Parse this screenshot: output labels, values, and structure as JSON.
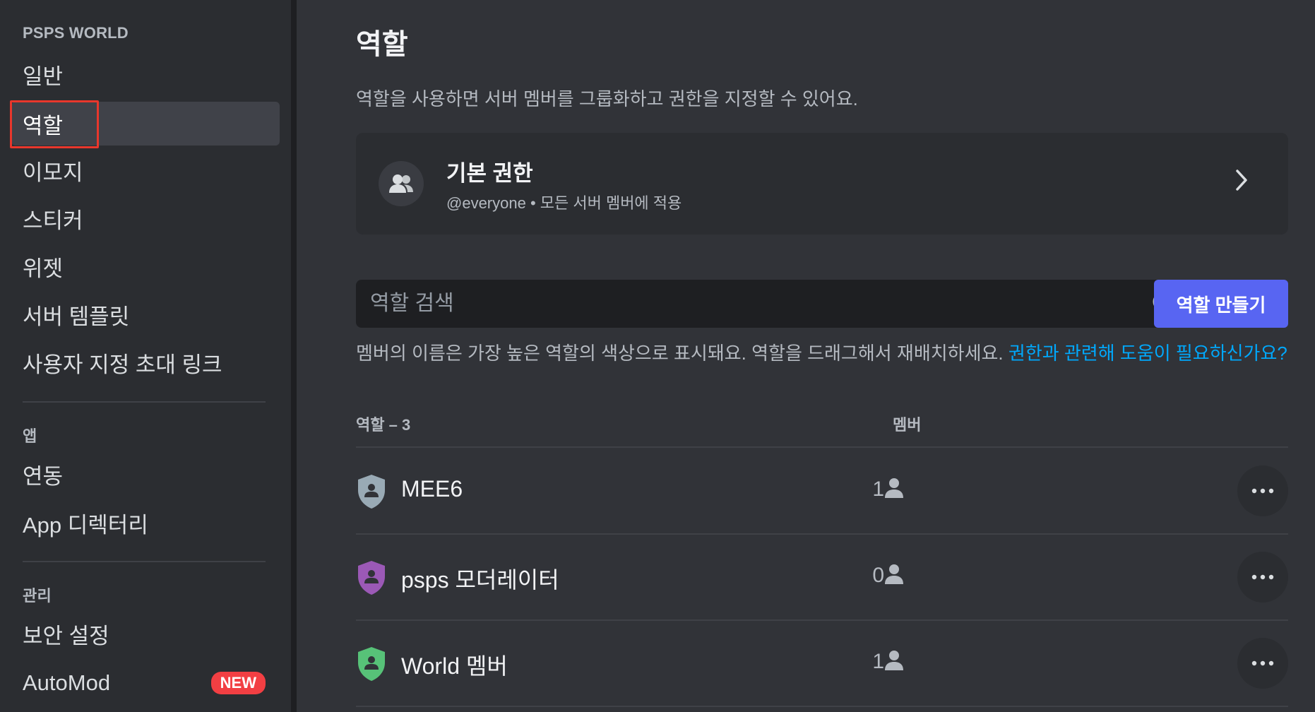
{
  "sidebar": {
    "server_name": "PSPS WORLD",
    "items": [
      {
        "label": "일반"
      },
      {
        "label": "역할"
      },
      {
        "label": "이모지"
      },
      {
        "label": "스티커"
      },
      {
        "label": "위젯"
      },
      {
        "label": "서버 템플릿"
      },
      {
        "label": "사용자 지정 초대 링크"
      }
    ],
    "app_header": "앱",
    "app_items": [
      {
        "label": "연동"
      },
      {
        "label": "App 디렉터리"
      }
    ],
    "manage_header": "관리",
    "manage_items": [
      {
        "label": "보안 설정"
      },
      {
        "label": "AutoMod",
        "badge": "NEW"
      }
    ]
  },
  "main": {
    "title": "역할",
    "description": "역할을 사용하면 서버 멤버를 그룹화하고 권한을 지정할 수 있어요.",
    "default_perms": {
      "title": "기본 권한",
      "subtitle": "@everyone • 모든 서버 멤버에 적용"
    },
    "search_placeholder": "역할 검색",
    "create_button": "역할 만들기",
    "info_text": "멤버의 이름은 가장 높은 역할의 색상으로 표시돼요. 역할을 드래그해서 재배치하세요.",
    "info_link": "권한과 관련해 도움이 필요하신가요?",
    "columns": {
      "roles": "역할 – 3",
      "members": "멤버"
    },
    "roles": [
      {
        "name": "MEE6",
        "count": "1",
        "color": "#99aab5"
      },
      {
        "name": "psps 모더레이터",
        "count": "0",
        "color": "#9b59b6"
      },
      {
        "name": "World 멤버",
        "count": "1",
        "color": "#57c278"
      }
    ]
  }
}
